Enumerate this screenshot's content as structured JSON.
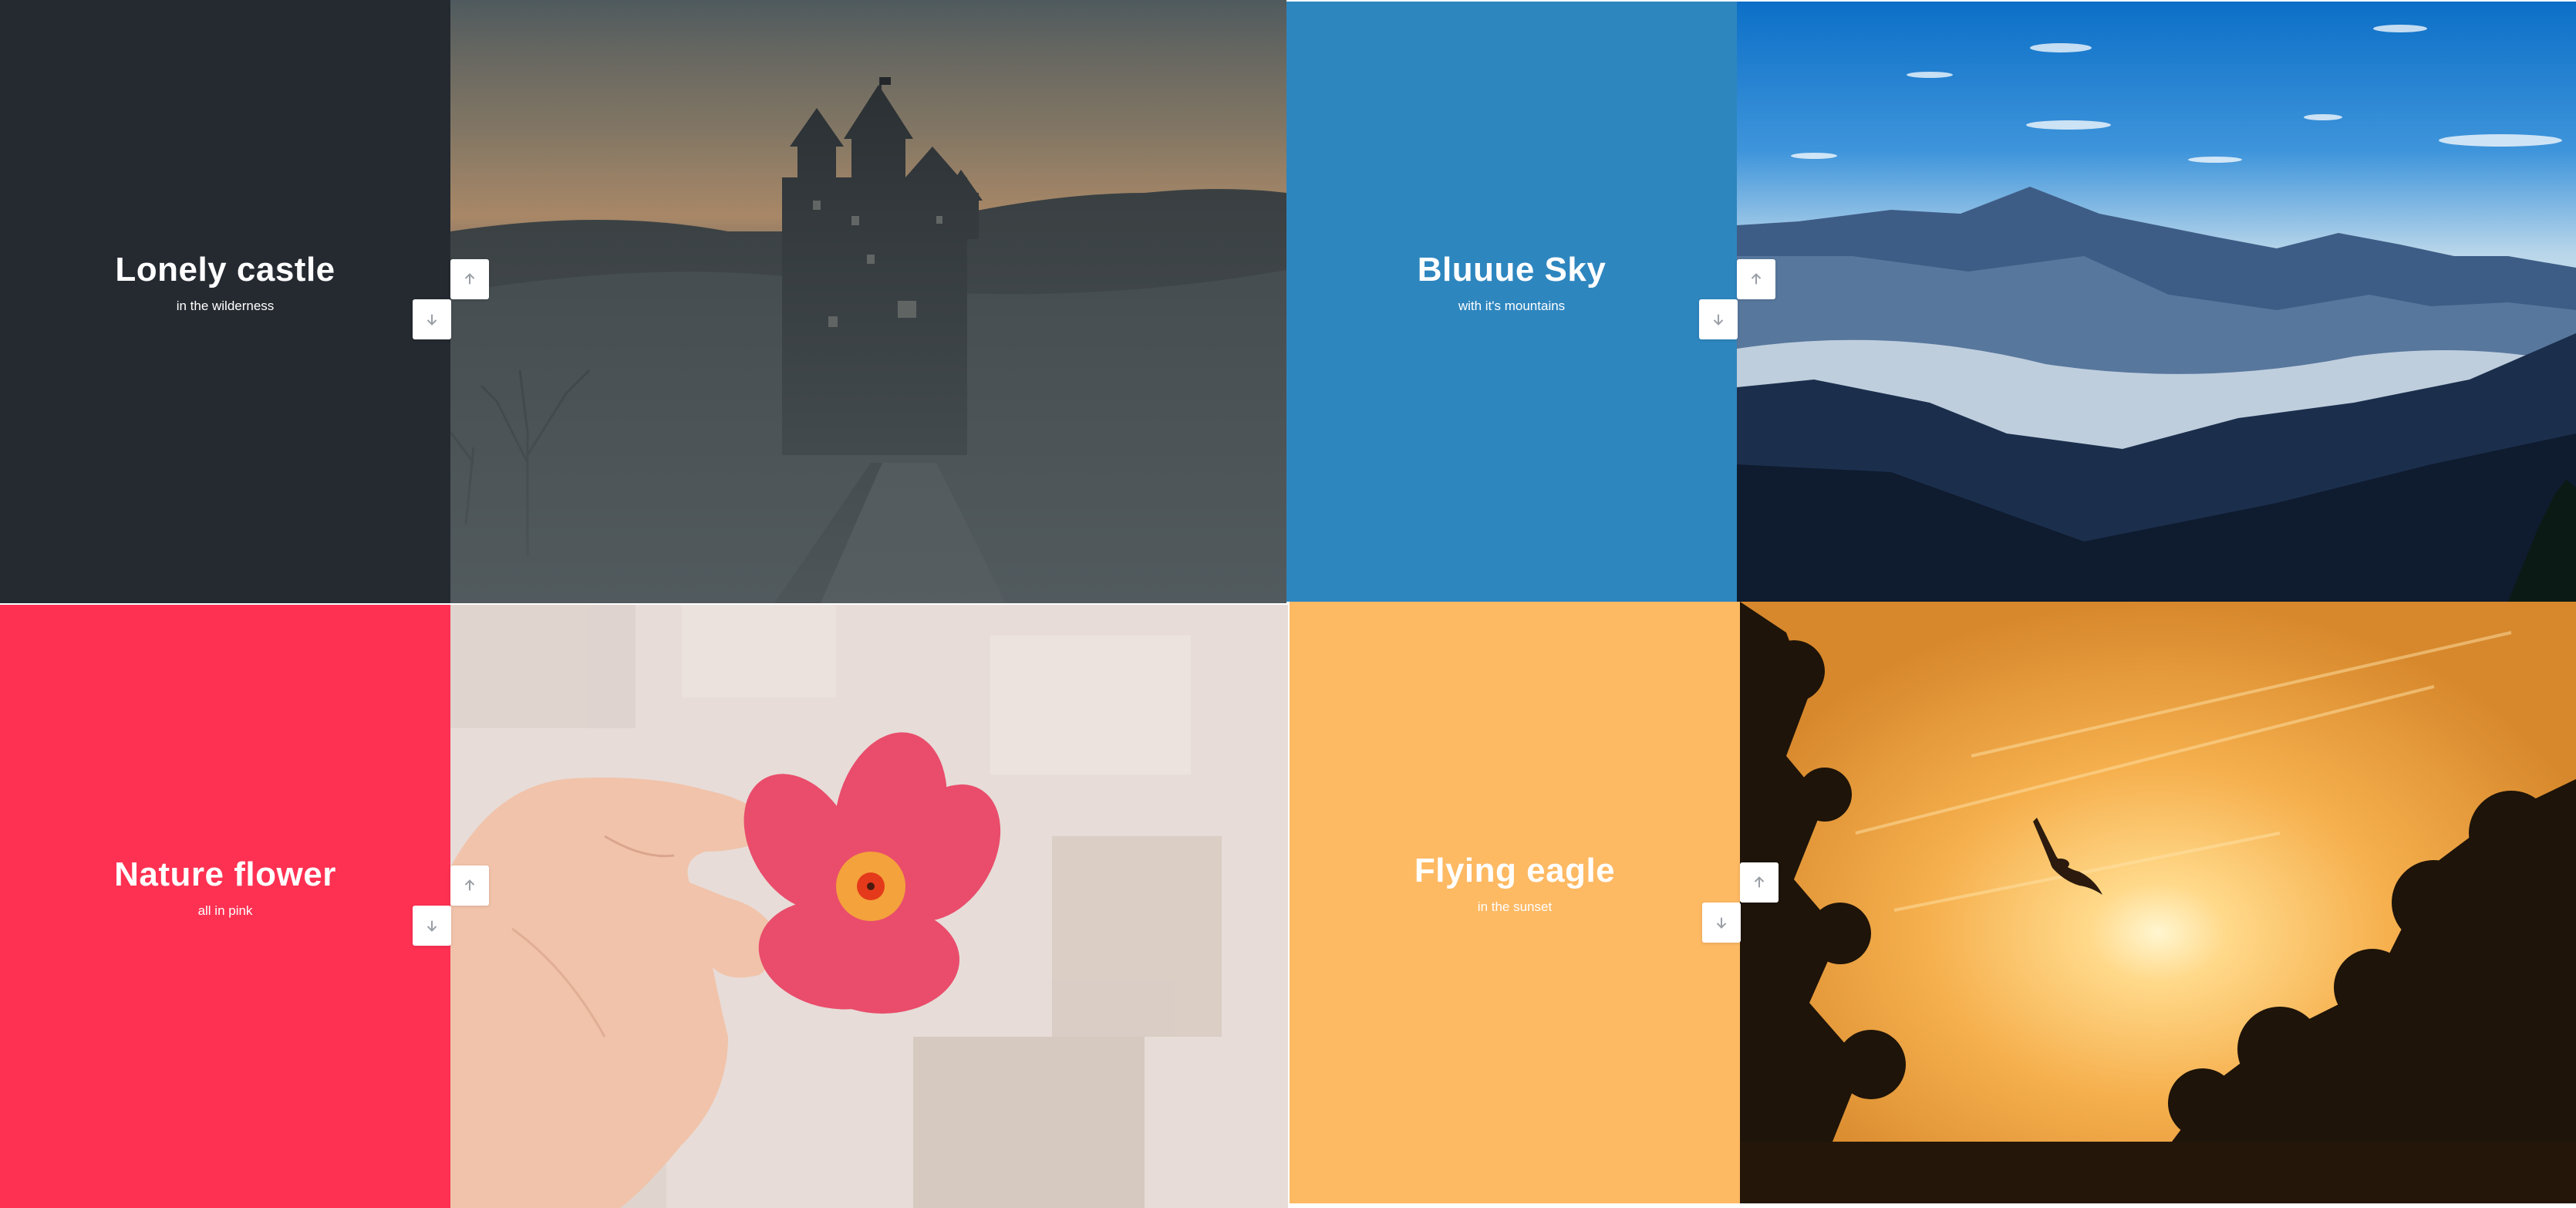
{
  "slides": [
    {
      "title": "Lonely castle",
      "subtitle": "in the wilderness",
      "color": "#252a31"
    },
    {
      "title": "Bluuue Sky",
      "subtitle": "with it's mountains",
      "color": "#2e86bf"
    },
    {
      "title": "Nature flower",
      "subtitle": "all in pink",
      "color": "#fe3152"
    },
    {
      "title": "Flying eagle",
      "subtitle": "in the sunset",
      "color": "#feb963"
    }
  ],
  "controls": {
    "up_icon": "arrow-up-icon",
    "down_icon": "arrow-down-icon"
  }
}
